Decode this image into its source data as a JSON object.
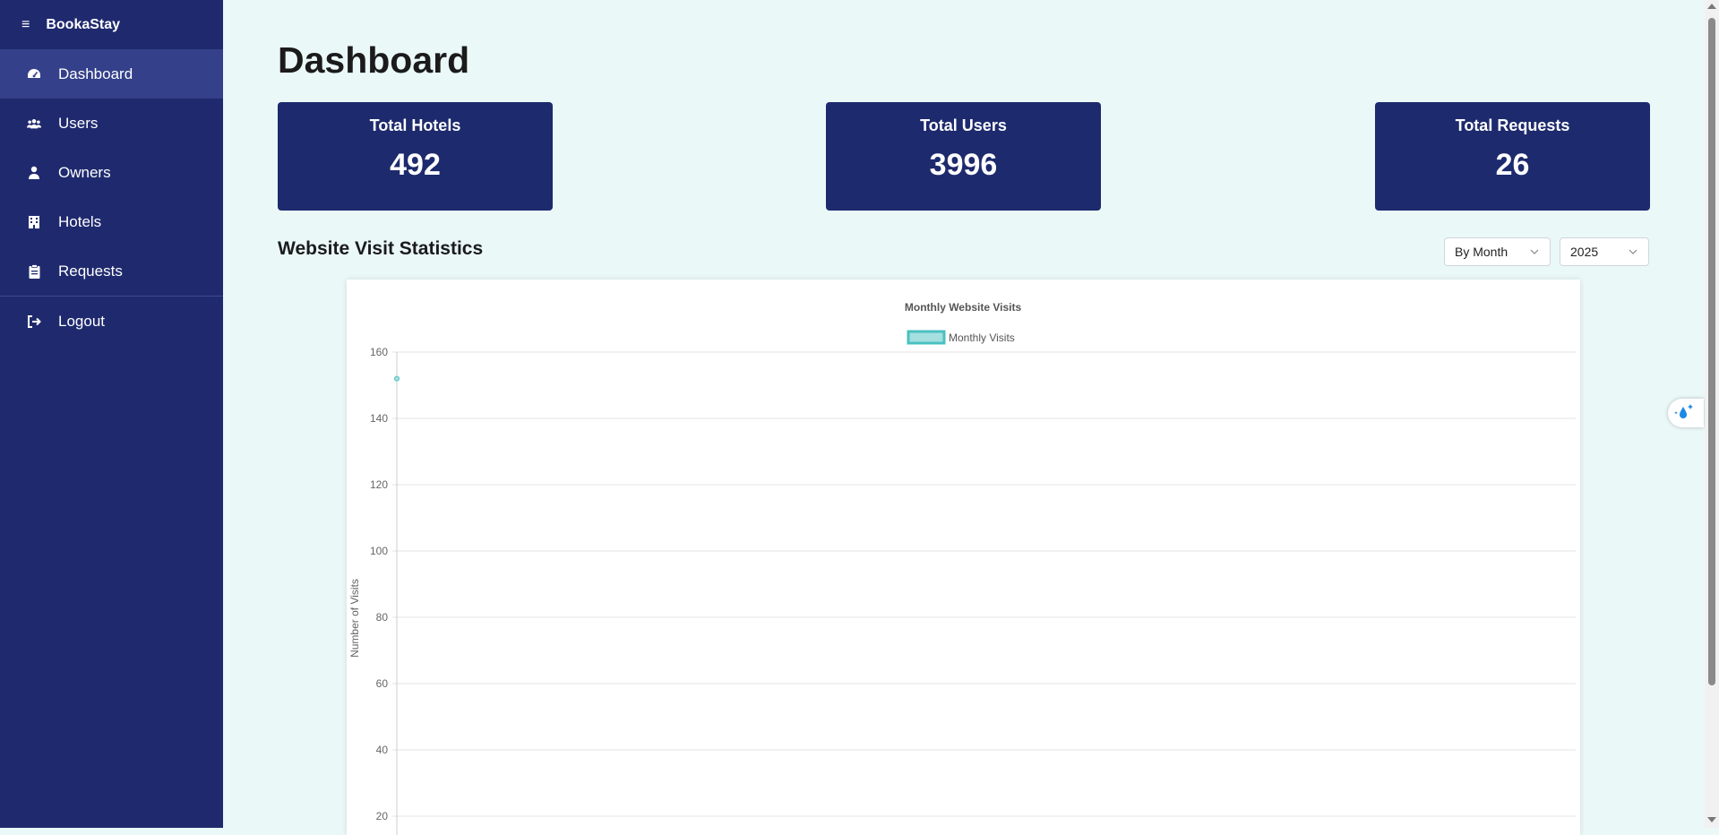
{
  "app": {
    "title": "BookaStay",
    "menu_icon": "hamburger-icon"
  },
  "sidebar": {
    "items": [
      {
        "label": "Dashboard",
        "icon": "gauge-icon",
        "active": true
      },
      {
        "label": "Users",
        "icon": "users-icon",
        "active": false
      },
      {
        "label": "Owners",
        "icon": "owner-icon",
        "active": false
      },
      {
        "label": "Hotels",
        "icon": "hotel-icon",
        "active": false
      },
      {
        "label": "Requests",
        "icon": "clipboard-icon",
        "active": false
      }
    ],
    "logout": {
      "label": "Logout",
      "icon": "logout-icon"
    }
  },
  "page": {
    "title": "Dashboard"
  },
  "stats": [
    {
      "label": "Total Hotels",
      "value": "492"
    },
    {
      "label": "Total Users",
      "value": "3996"
    },
    {
      "label": "Total Requests",
      "value": "26"
    }
  ],
  "visits": {
    "section_title": "Website Visit Statistics",
    "period_select": {
      "value": "By Month"
    },
    "year_select": {
      "value": "2025"
    }
  },
  "chart_data": {
    "type": "line",
    "title": "Monthly Website Visits",
    "ylabel": "Number of Visits",
    "xlabel": "",
    "ylim": [
      20,
      160
    ],
    "yticks": [
      160,
      140,
      120,
      100,
      80,
      60,
      40,
      20
    ],
    "grid": true,
    "legend_position": "top-center",
    "series": [
      {
        "name": "Monthly Visits",
        "color": "#4bc0c0",
        "values": [
          152
        ]
      }
    ]
  },
  "colors": {
    "sidebar": "#1f2a6e",
    "card": "#1d2a6d",
    "background": "#ebf8f8",
    "series": "#4bc0c0"
  }
}
